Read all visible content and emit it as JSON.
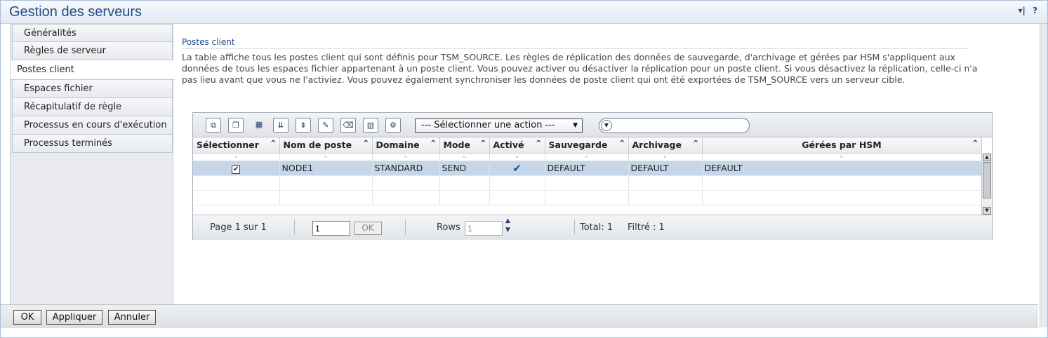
{
  "window": {
    "title": "Gestion des serveurs",
    "tool_menu": "▾|",
    "help": "?"
  },
  "nav": {
    "items": [
      {
        "label": "Généralités"
      },
      {
        "label": "Règles de serveur"
      },
      {
        "label": "Postes client"
      },
      {
        "label": "Espaces fichier"
      },
      {
        "label": "Récapitulatif de règle"
      },
      {
        "label": "Processus en cours d'exécution"
      },
      {
        "label": "Processus terminés"
      }
    ],
    "active_index": 2
  },
  "section": {
    "title": "Postes client",
    "description": "La table affiche tous les postes client qui sont définis pour TSM_SOURCE. Les règles de réplication des données de sauvegarde, d'archivage et gérées par HSM s'appliquent aux données de tous les espaces fichier appartenant à un poste client. Vous pouvez activer ou désactiver la réplication pour un poste client. Si vous désactivez la réplication, celle-ci n'a pas lieu avant que vous ne l'activiez. Vous pouvez également synchroniser les données de poste client qui ont été exportées de TSM_SOURCE vers un serveur cible."
  },
  "toolbar": {
    "icons": [
      "select-all-icon",
      "deselect-all-icon",
      "edit-table-icon",
      "filter-icon",
      "clear-filter-icon",
      "edit-sort-icon",
      "clear-sort-icon",
      "columns-icon",
      "settings-icon"
    ],
    "action_select": "--- Sélectionner une action ---",
    "filter_placeholder": ""
  },
  "table": {
    "columns": [
      "Sélectionner",
      "Nom de poste",
      "Domaine",
      "Mode",
      "Activé",
      "Sauvegarde",
      "Archivage",
      "Gérées par HSM"
    ],
    "rows": [
      {
        "selected": true,
        "node": "NODE1",
        "domain": "STANDARD",
        "mode": "SEND",
        "enabled": "✔",
        "backup": "DEFAULT",
        "archive": "DEFAULT",
        "hsm": "DEFAULT"
      }
    ]
  },
  "pager": {
    "page_info": "Page 1 sur 1",
    "page_input": "1",
    "ok": "OK",
    "rows_label": "Rows",
    "rows_value": "1",
    "total": "Total: 1",
    "filtered": "Filtré : 1"
  },
  "footer": {
    "ok": "OK",
    "apply": "Appliquer",
    "cancel": "Annuler"
  },
  "colors": {
    "title": "#1f4f8a",
    "selected_row": "#c5d6e8"
  }
}
